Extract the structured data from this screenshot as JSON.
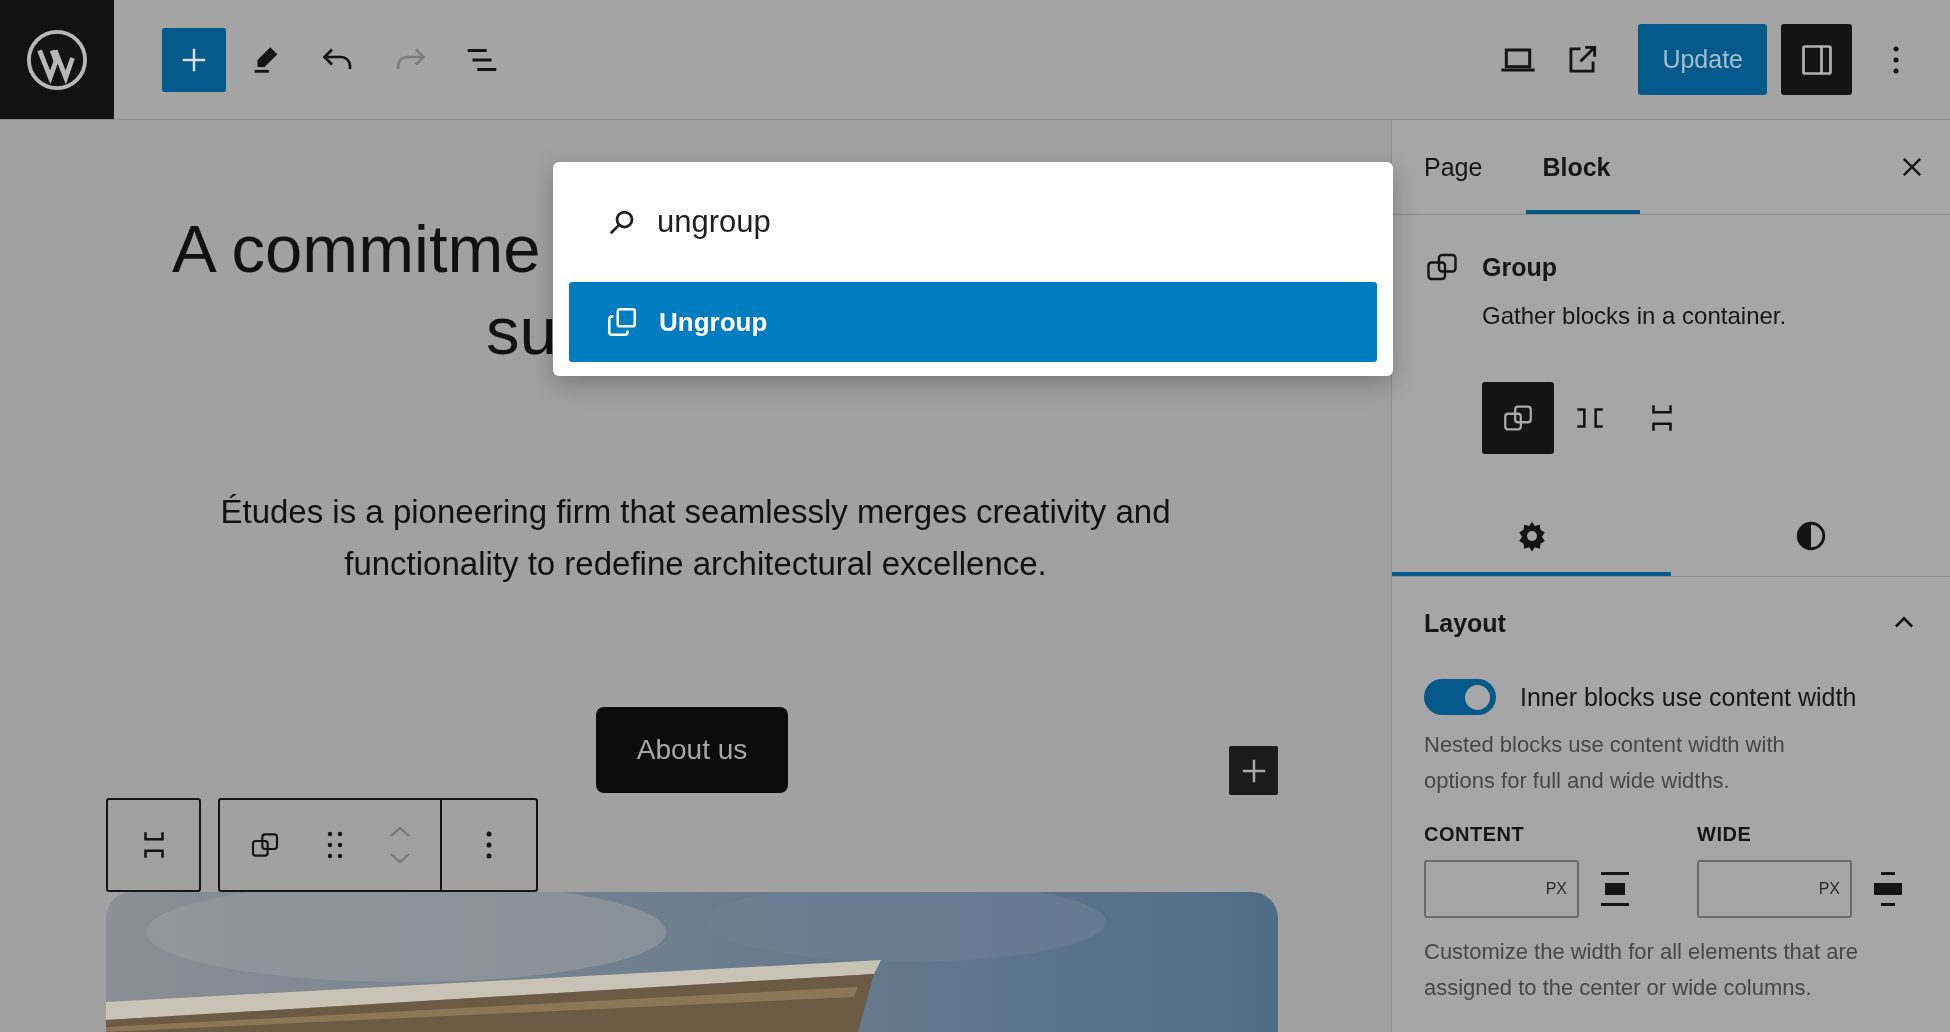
{
  "toolbar": {
    "tools": [
      {
        "kind": "inserter",
        "disabled": false
      },
      {
        "kind": "edit",
        "disabled": false
      },
      {
        "kind": "undo",
        "disabled": false
      },
      {
        "kind": "redo",
        "disabled": true
      },
      {
        "kind": "list",
        "disabled": false
      }
    ],
    "update_button": "Update"
  },
  "command_palette": {
    "query": "ungroup",
    "results": [
      {
        "label": "Ungroup",
        "selected": true
      }
    ]
  },
  "canvas": {
    "heading_lines": [
      "A commitme",
      "su"
    ],
    "paragraph_lines": [
      "Études is a pioneering firm that seamlessly merges creativity and",
      "functionality to redefine architectural excellence."
    ],
    "button": "About us",
    "image": {
      "kind": "picture"
    }
  },
  "sidebar": {
    "tabs": [
      {
        "label": "Page",
        "selected": false
      },
      {
        "label": "Block",
        "selected": true
      }
    ],
    "block": {
      "name": "Group",
      "description": "Gather blocks in a container."
    },
    "variations": [
      {
        "kind": "group",
        "selected": true
      },
      {
        "kind": "row",
        "selected": false
      },
      {
        "kind": "stack",
        "selected": false
      }
    ],
    "settings_tabs": [
      {
        "kind": "settings",
        "selected": true
      },
      {
        "kind": "styles",
        "selected": false
      }
    ],
    "layout": {
      "title": "Layout",
      "expanded": true,
      "toggle": {
        "label": "Inner blocks use content width",
        "on": true
      },
      "toggle_help": "Nested blocks use content width with options for full and wide widths.",
      "fields": [
        {
          "label": "CONTENT",
          "unit": "PX",
          "kind": "content"
        },
        {
          "label": "WIDE",
          "unit": "PX",
          "kind": "wide"
        }
      ],
      "help": "Customize the width for all elements that are assigned to the center or wide columns."
    }
  }
}
